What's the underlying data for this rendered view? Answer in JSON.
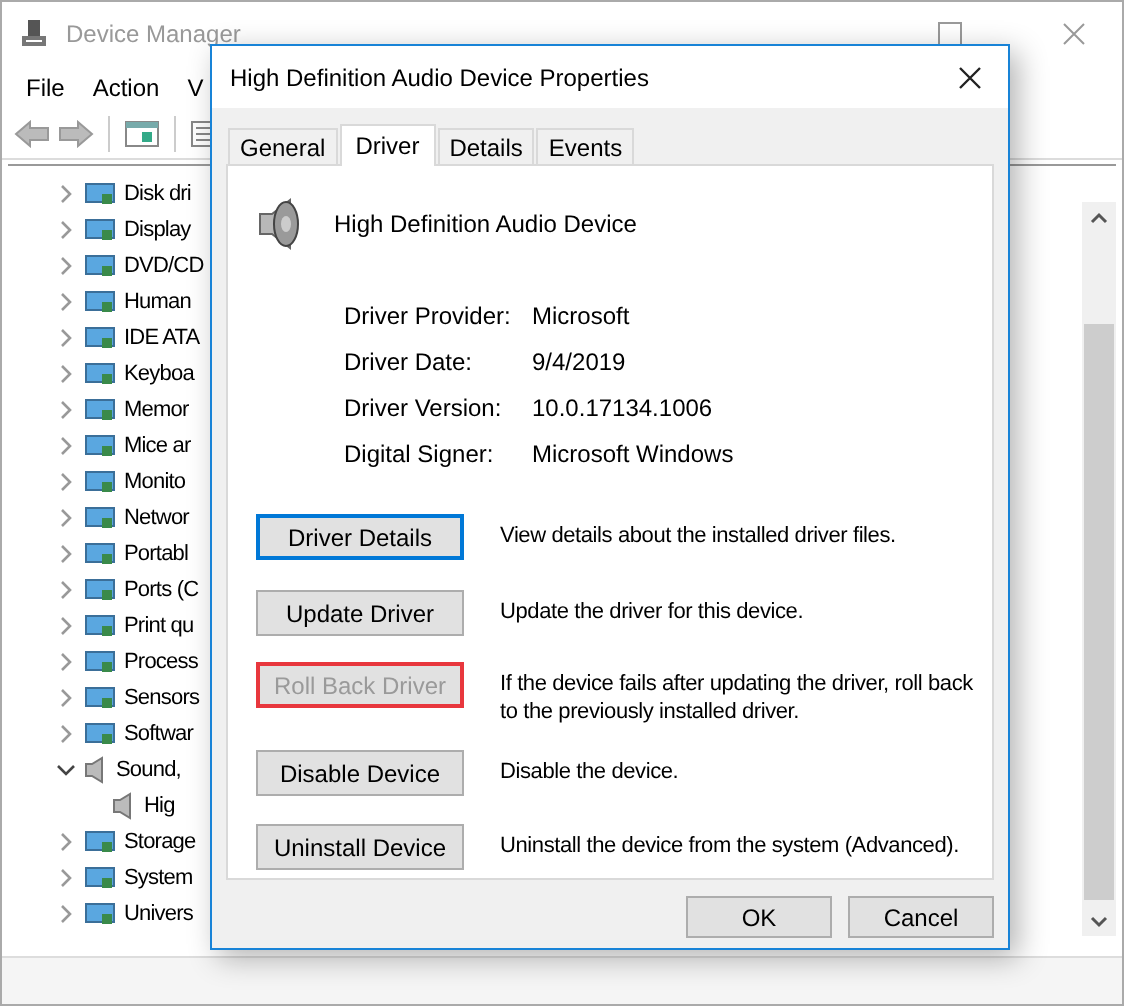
{
  "background_window": {
    "title": "Device Manager",
    "menu": [
      "File",
      "Action",
      "V"
    ],
    "tree": [
      {
        "label": "Disk dri",
        "expanded": false
      },
      {
        "label": "Display",
        "expanded": false
      },
      {
        "label": "DVD/CD",
        "expanded": false
      },
      {
        "label": "Human",
        "expanded": false
      },
      {
        "label": "IDE ATA",
        "expanded": false
      },
      {
        "label": "Keyboa",
        "expanded": false
      },
      {
        "label": "Memor",
        "expanded": false
      },
      {
        "label": "Mice ar",
        "expanded": false
      },
      {
        "label": "Monito",
        "expanded": false
      },
      {
        "label": "Networ",
        "expanded": false
      },
      {
        "label": "Portabl",
        "expanded": false
      },
      {
        "label": "Ports (C",
        "expanded": false
      },
      {
        "label": "Print qu",
        "expanded": false
      },
      {
        "label": "Process",
        "expanded": false
      },
      {
        "label": "Sensors",
        "expanded": false
      },
      {
        "label": "Softwar",
        "expanded": false
      },
      {
        "label": "Sound,",
        "expanded": true,
        "children": [
          {
            "label": "Hig"
          }
        ]
      },
      {
        "label": "Storage",
        "expanded": false
      },
      {
        "label": "System",
        "expanded": false
      },
      {
        "label": "Univers",
        "expanded": false
      }
    ]
  },
  "dialog": {
    "title": "High Definition Audio Device Properties",
    "tabs": [
      {
        "label": "General",
        "selected": false
      },
      {
        "label": "Driver",
        "selected": true
      },
      {
        "label": "Details",
        "selected": false
      },
      {
        "label": "Events",
        "selected": false
      }
    ],
    "device_name": "High Definition Audio Device",
    "properties": [
      {
        "label": "Driver Provider:",
        "value": "Microsoft"
      },
      {
        "label": "Driver Date:",
        "value": "9/4/2019"
      },
      {
        "label": "Driver Version:",
        "value": "10.0.17134.1006"
      },
      {
        "label": "Digital Signer:",
        "value": "Microsoft Windows"
      }
    ],
    "actions": [
      {
        "button": "Driver Details",
        "description": "View details about the installed driver files.",
        "focused": true,
        "disabled": false,
        "highlighted": false
      },
      {
        "button": "Update Driver",
        "description": "Update the driver for this device.",
        "focused": false,
        "disabled": false,
        "highlighted": false
      },
      {
        "button": "Roll Back Driver",
        "description": "If the device fails after updating the driver, roll back to the previously installed driver.",
        "focused": false,
        "disabled": true,
        "highlighted": true
      },
      {
        "button": "Disable Device",
        "description": "Disable the device.",
        "focused": false,
        "disabled": false,
        "highlighted": false
      },
      {
        "button": "Uninstall Device",
        "description": "Uninstall the device from the system (Advanced).",
        "focused": false,
        "disabled": false,
        "highlighted": false
      }
    ],
    "buttons": [
      "OK",
      "Cancel"
    ]
  }
}
